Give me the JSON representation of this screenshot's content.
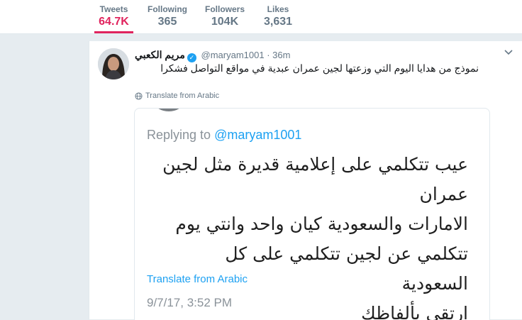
{
  "profile_nav": {
    "stats": [
      {
        "label": "Tweets",
        "value": "64.7K",
        "active": true
      },
      {
        "label": "Following",
        "value": "365",
        "active": false
      },
      {
        "label": "Followers",
        "value": "104K",
        "active": false
      },
      {
        "label": "Likes",
        "value": "3,631",
        "active": false
      }
    ]
  },
  "tweet": {
    "fullname": "مريم الكعبي",
    "handle": "@maryam1001",
    "separator": "·",
    "time": "36m",
    "text": "نموذج من هدايا اليوم التي وزعتها لجين عمران عبدية في مواقع التواصل فشكرا",
    "translate_label": "Translate from Arabic",
    "media": {
      "replying_prefix": "Replying to",
      "replying_handle": "@maryam1001",
      "quoted_lines": [
        "عيب تتكلمي على إعلامية قديرة مثل لجين عمران",
        "الامارات والسعودية كيان واحد وانتي يوم",
        "تتكلمي عن لجين تتكلمي على كل السعودية",
        "ارتقي بألفاظك"
      ],
      "translate_label": "Translate from Arabic",
      "date": "9/7/17, 3:52 PM"
    }
  },
  "colors": {
    "accent": "#e0245e",
    "link": "#1da1f2",
    "muted": "#657786",
    "background": "#e6ecf0"
  },
  "icons": {
    "verified": "verified-badge-icon",
    "caret": "chevron-down-icon",
    "globe": "globe-icon"
  }
}
